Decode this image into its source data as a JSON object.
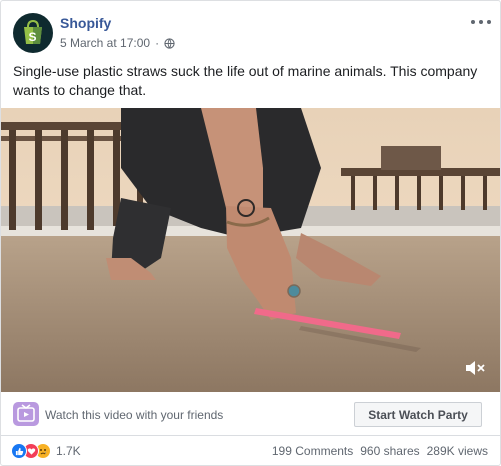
{
  "post": {
    "page_name": "Shopify",
    "timestamp": "5 March at 17:00",
    "separator": "·",
    "text": "Single-use plastic straws suck the life out of marine animals. This company wants to change that.",
    "icons": {
      "avatar": "shopify-bag-icon",
      "privacy": "globe-icon",
      "more": "more-options-icon"
    }
  },
  "video": {
    "icons": {
      "volume": "muted-speaker-icon"
    }
  },
  "watch_party": {
    "prompt": "Watch this video with your friends",
    "button_label": "Start Watch Party",
    "icon": "watch-party-icon"
  },
  "engagement": {
    "reactions": [
      "like",
      "love",
      "sad"
    ],
    "reaction_count": "1.7K",
    "comments": "199 Comments",
    "shares": "960 shares",
    "views": "289K views"
  },
  "colors": {
    "page_name": "#385898",
    "meta_text": "#606770",
    "like": "#1877f2",
    "love": "#f33e58",
    "sad": "#f7b125",
    "watch_party_icon": "#b999df",
    "avatar_bg": "#0f2a2f",
    "shopify_green": "#95bf47"
  }
}
